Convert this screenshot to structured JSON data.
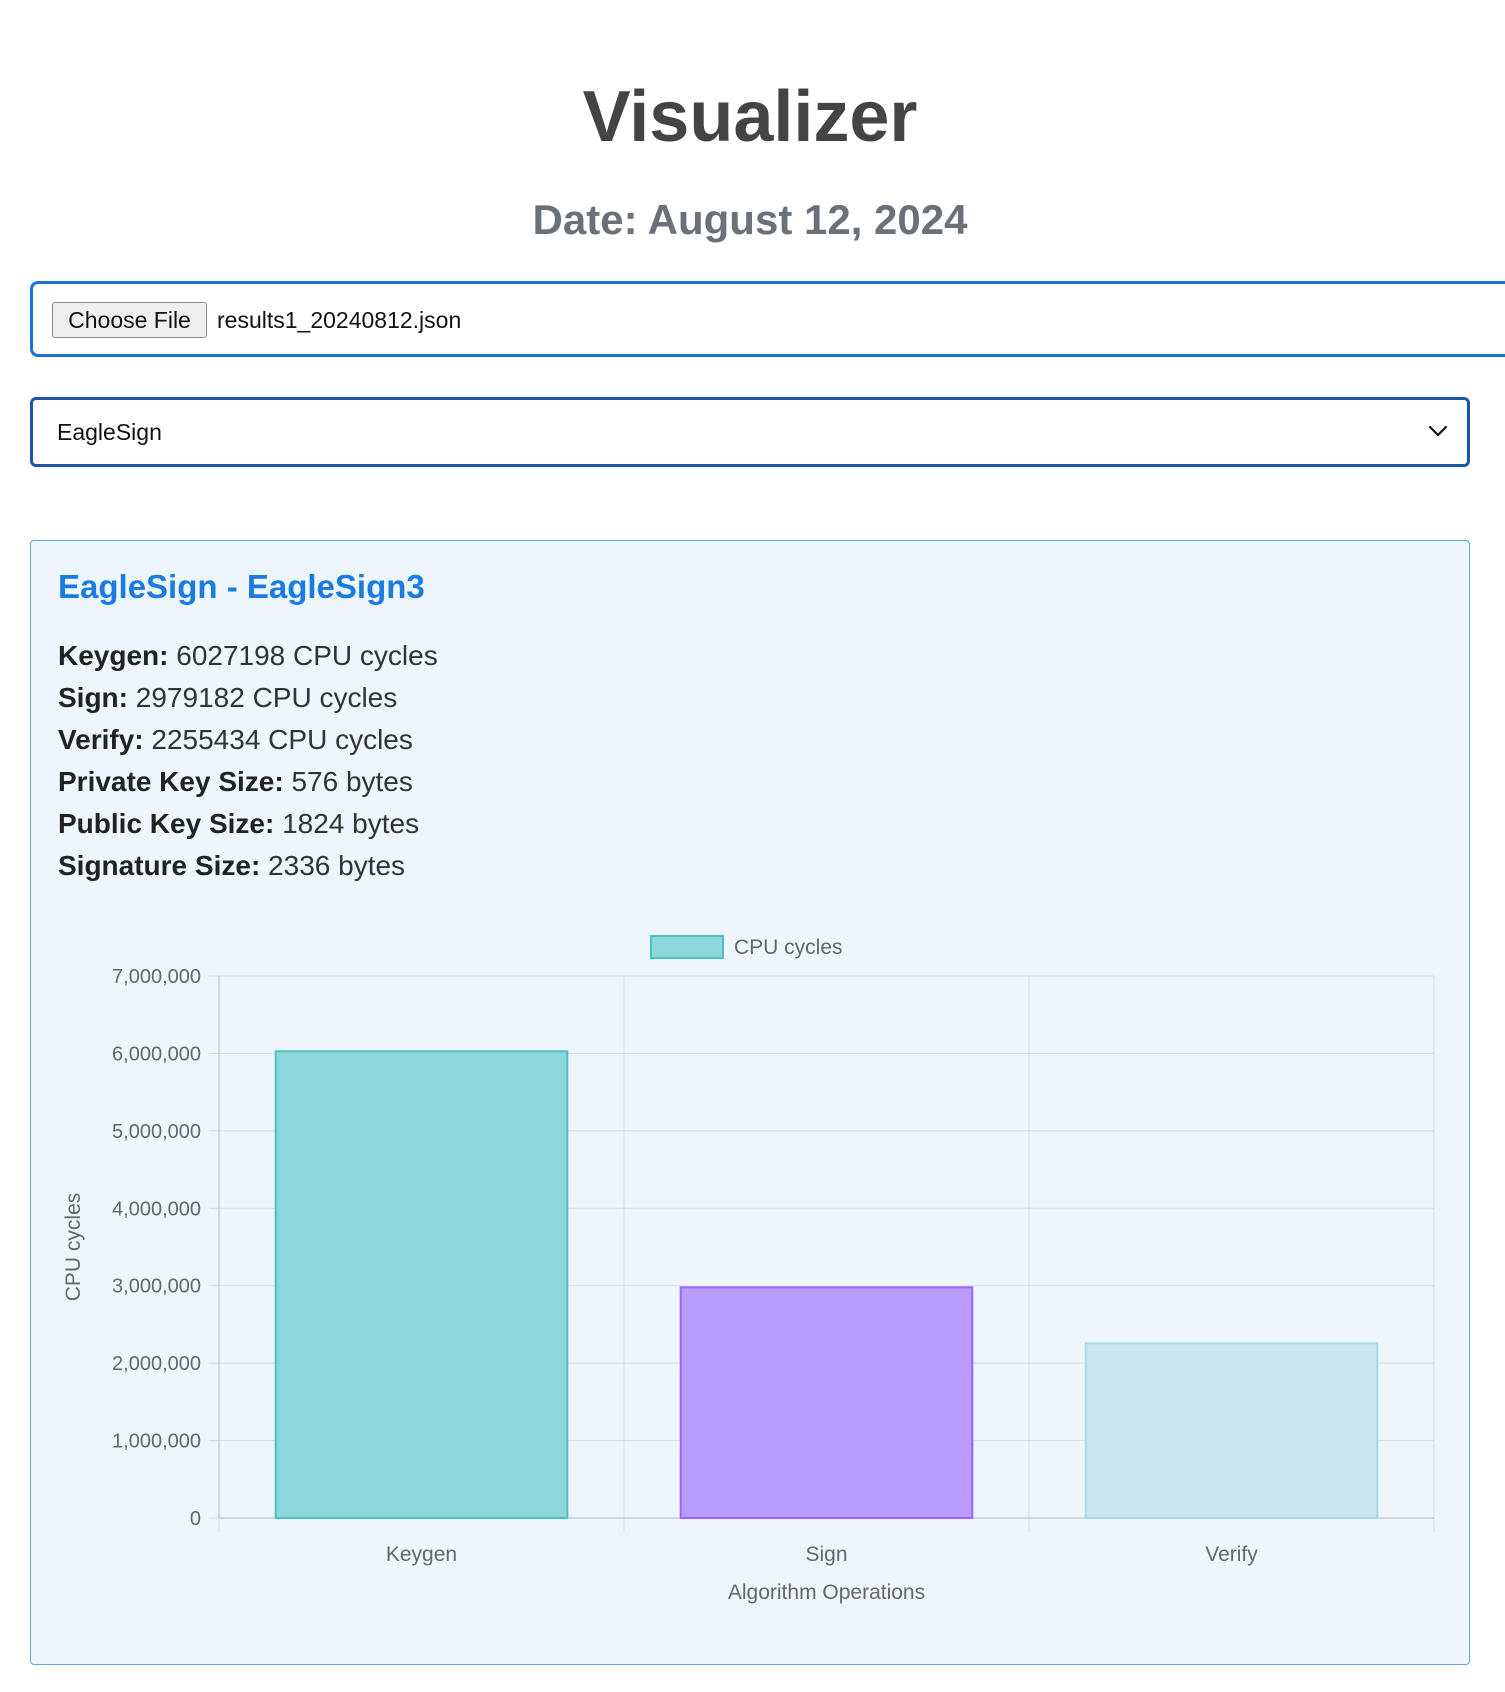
{
  "page": {
    "title": "Visualizer",
    "date": "Date: August 12, 2024"
  },
  "file_input": {
    "button_label": "Choose File",
    "file_name": "results1_20240812.json"
  },
  "algorithm_select": {
    "selected": "EagleSign"
  },
  "card": {
    "title": "EagleSign - EagleSign3",
    "stats": [
      {
        "label": "Keygen:",
        "value": "6027198 CPU cycles"
      },
      {
        "label": "Sign:",
        "value": "2979182 CPU cycles"
      },
      {
        "label": "Verify:",
        "value": "2255434 CPU cycles"
      },
      {
        "label": "Private Key Size:",
        "value": "576 bytes"
      },
      {
        "label": "Public Key Size:",
        "value": "1824 bytes"
      },
      {
        "label": "Signature Size:",
        "value": "2336 bytes"
      }
    ]
  },
  "chart_data": {
    "type": "bar",
    "categories": [
      "Keygen",
      "Sign",
      "Verify"
    ],
    "series": [
      {
        "name": "CPU cycles",
        "values": [
          6027198,
          2979182,
          2255434
        ]
      }
    ],
    "bar_colors": [
      "#8dd6da",
      "#b79cfd",
      "#c9e5ef"
    ],
    "bar_border_colors": [
      "#4bc0c0",
      "#9966ff",
      "#a9d8e4"
    ],
    "legend_color": "#8dd6da",
    "legend_position": "top",
    "xlabel": "Algorithm Operations",
    "ylabel": "CPU cycles",
    "ylim": [
      0,
      7000000
    ],
    "yticks": [
      0,
      1000000,
      2000000,
      3000000,
      4000000,
      5000000,
      6000000,
      7000000
    ],
    "ytick_labels": [
      "0",
      "1,000,000",
      "2,000,000",
      "3,000,000",
      "4,000,000",
      "5,000,000",
      "6,000,000",
      "7,000,000"
    ],
    "grid": true
  }
}
